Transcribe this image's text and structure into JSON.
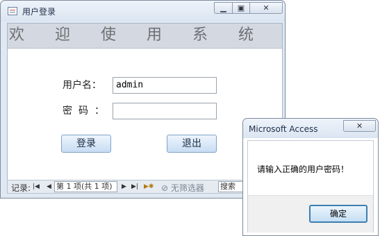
{
  "login_window": {
    "title": "用户登录",
    "welcome": "欢迎使用系统",
    "username_label": "用户名：",
    "username_value": "admin",
    "password_label": "密码：",
    "password_value": "",
    "login_button": "登录",
    "exit_button": "退出",
    "navigation": {
      "record_label": "记录:",
      "record_position": "第 1 项(共 1 项)",
      "filter_label": "无筛选器",
      "search_label": "搜索"
    }
  },
  "message_box": {
    "title": "Microsoft Access",
    "message": "请输入正确的用户密码！",
    "ok_button": "确定"
  },
  "icons": [
    "form-icon",
    "minimize-icon",
    "maximize-icon",
    "close-icon",
    "first-record-icon",
    "previous-record-icon",
    "next-record-icon",
    "last-record-icon",
    "new-record-icon",
    "filter-icon"
  ]
}
